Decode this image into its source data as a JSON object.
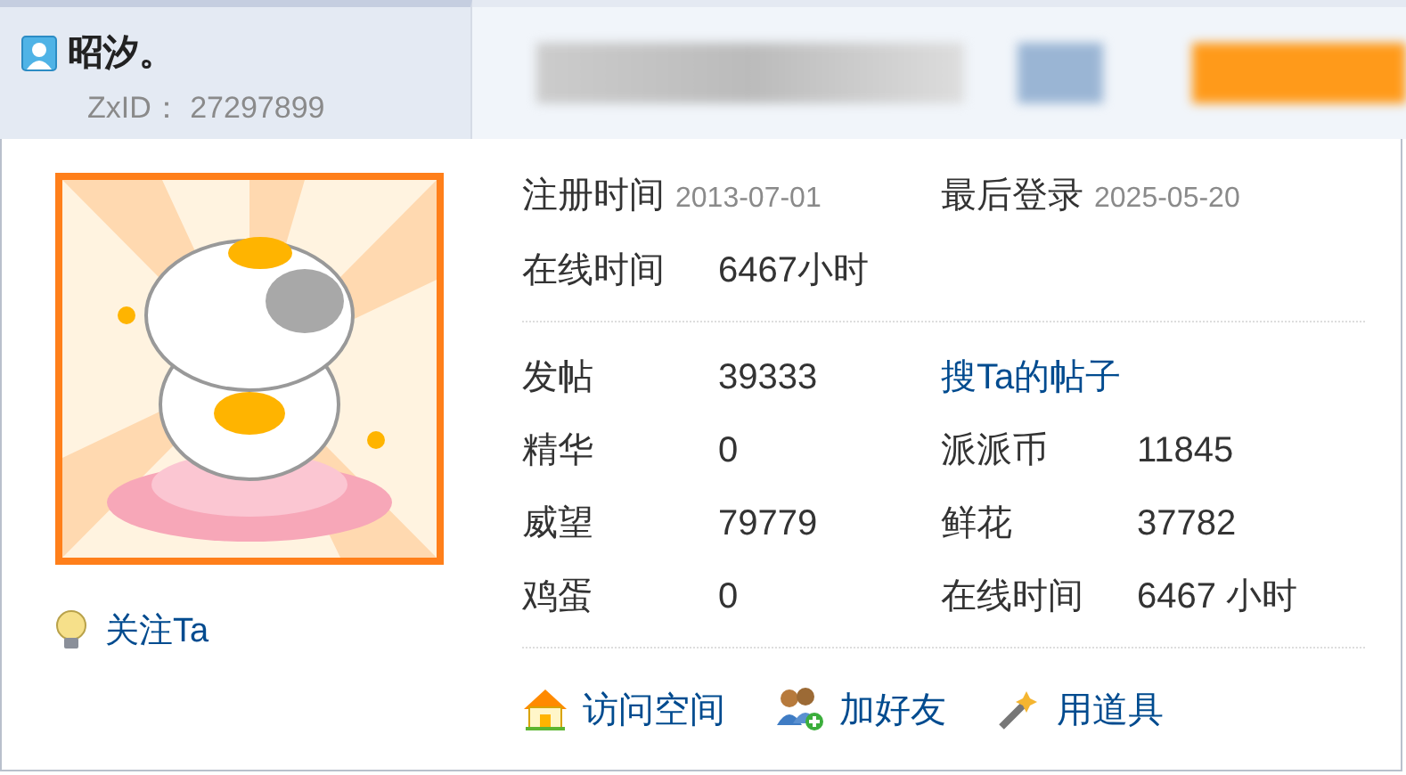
{
  "user": {
    "name": "昭汐。",
    "id_text": "ZxID：  27297899"
  },
  "follow": "关注Ta",
  "dates": [
    {
      "label": "注册时间",
      "value": "2013-07-01"
    },
    {
      "label": "最后登录",
      "value": "2025-05-20"
    }
  ],
  "online": {
    "label": "在线时间",
    "value": "6467小时"
  },
  "stats": [
    {
      "kind": "stat",
      "label": "发帖",
      "value": "39333"
    },
    {
      "kind": "link",
      "label": "搜Ta的帖子"
    },
    {
      "kind": "stat",
      "label": "精华",
      "value": "0"
    },
    {
      "kind": "stat",
      "label": "派派币",
      "value": "11845"
    },
    {
      "kind": "stat",
      "label": "威望",
      "value": "79779"
    },
    {
      "kind": "stat",
      "label": "鲜花",
      "value": "37782"
    },
    {
      "kind": "stat",
      "label": "鸡蛋",
      "value": "0"
    },
    {
      "kind": "stat",
      "label": "在线时间",
      "value": "6467 小时"
    }
  ],
  "actions": [
    {
      "kind": "house",
      "label": "访问空间"
    },
    {
      "kind": "add-friend",
      "label": "加好友"
    },
    {
      "kind": "wand",
      "label": "用道具"
    }
  ]
}
